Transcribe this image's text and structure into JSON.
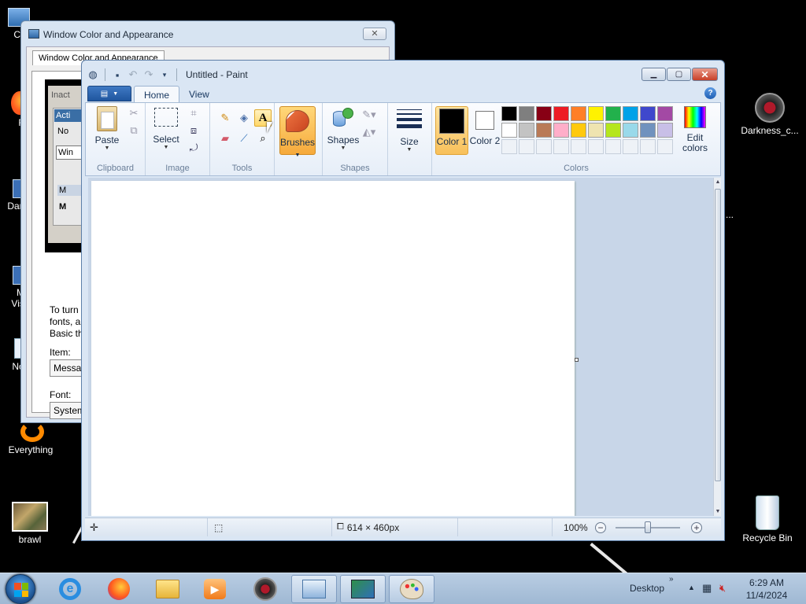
{
  "desktop": {
    "icons": [
      {
        "label": "Co"
      },
      {
        "label": "F"
      },
      {
        "label": "Dark"
      },
      {
        "label": "M Visu"
      },
      {
        "label": "No"
      },
      {
        "label": "Everything"
      },
      {
        "label": "brawl"
      },
      {
        "label": "Darkness_c..."
      },
      {
        "label": "Recycle Bin"
      }
    ],
    "ellipsis": "..."
  },
  "dialog": {
    "title": "Window Color and Appearance",
    "tab": "Window Color and Appearance",
    "preview_labels": [
      "Inact",
      "Acti",
      "No",
      "Win",
      "M",
      "M"
    ],
    "description": [
      "To turn o",
      "fonts, an",
      "Basic the"
    ],
    "item_label": "Item:",
    "item_value": "Message",
    "font_label": "Font:",
    "font_value": "System"
  },
  "paint": {
    "title": "Untitled - Paint",
    "tabs": {
      "home": "Home",
      "view": "View"
    },
    "help": "?",
    "groups": {
      "clipboard": "Clipboard",
      "image": "Image",
      "tools": "Tools",
      "shapes": "Shapes",
      "colors": "Colors"
    },
    "buttons": {
      "paste": "Paste",
      "select": "Select",
      "brushes": "Brushes",
      "shapes": "Shapes",
      "size": "Size",
      "color1": "Color 1",
      "color2": "Color 2",
      "edit_colors": "Edit colors"
    },
    "palette_row1": [
      "#000000",
      "#7f7f7f",
      "#880015",
      "#ed1c24",
      "#ff7f27",
      "#fff200",
      "#22b14c",
      "#00a2e8",
      "#3f48cc",
      "#a349a4"
    ],
    "palette_row2": [
      "#ffffff",
      "#c3c3c3",
      "#b97a57",
      "#ffaec9",
      "#ffc90e",
      "#efe4b0",
      "#b5e61d",
      "#99d9ea",
      "#7092be",
      "#c8bfe7"
    ],
    "color1_value": "#000000",
    "color2_value": "#ffffff",
    "status": {
      "image_size": "614 × 460px",
      "zoom": "100%"
    }
  },
  "taskbar": {
    "desktop_label": "Desktop",
    "time": "6:29 AM",
    "date": "11/4/2024"
  }
}
